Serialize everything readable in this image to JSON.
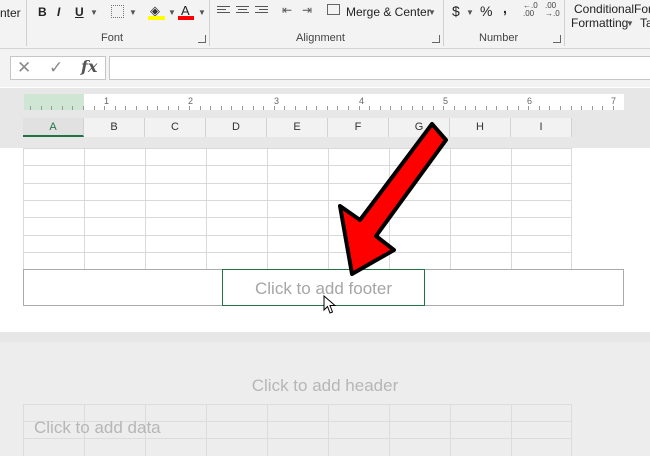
{
  "ribbon": {
    "merge_center_label": "Merge & Center",
    "truncated_center_label": "nter",
    "conditional_formatting_line1": "Conditional",
    "conditional_formatting_line2": "Formatting",
    "format_table_line1": "For",
    "format_table_line2": "Ta",
    "bold": "B",
    "italic": "I",
    "underline": "U",
    "font_color_glyph": "A",
    "currency_glyph": "$",
    "percent_glyph": "%",
    "comma_glyph": ",",
    "groups": {
      "font": "Font",
      "alignment": "Alignment",
      "number": "Number"
    },
    "colors": {
      "fill_highlight": "#ffff00",
      "font_color": "#ff0000"
    }
  },
  "formula_bar": {
    "cancel_glyph": "✕",
    "enter_glyph": "✓",
    "fx_label": "fx",
    "value": ""
  },
  "ruler": {
    "numbers": [
      "1",
      "2",
      "3",
      "4",
      "5",
      "6",
      "7"
    ]
  },
  "columns": [
    "A",
    "B",
    "C",
    "D",
    "E",
    "F",
    "G",
    "H",
    "I"
  ],
  "selected_column": "A",
  "page1": {
    "footer_placeholder": "Click to add footer"
  },
  "page2": {
    "header_placeholder": "Click to add header",
    "data_placeholder": "Click to add data"
  },
  "colors": {
    "accent_green": "#217346",
    "arrow_red": "#ff0000"
  }
}
